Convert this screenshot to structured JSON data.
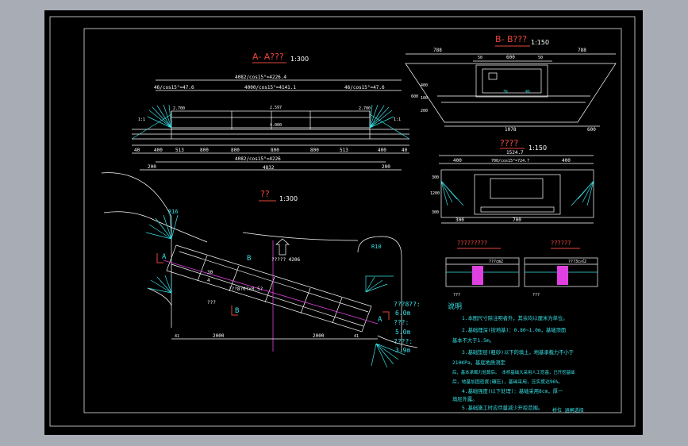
{
  "colors": {
    "background": "#a8acb5",
    "paper": "#000000",
    "line": "#ffffff",
    "annotation": "#35e0e6",
    "axis": "#e040e0",
    "title": "#e6463c"
  },
  "section_aa": {
    "title": "A- A???",
    "scale": "1:300",
    "dims_top": [
      "4082/cos15°=4226.4",
      "46/cos15°=47.6",
      "4000/cos15°=4141.1",
      "46/cos15°=47.6"
    ],
    "dims_bottom": [
      "40",
      "400",
      "513",
      "800",
      "800",
      "800",
      "800",
      "513",
      "400",
      "40"
    ],
    "dim_total": "4082/cos15°=4226",
    "dim_overall": "4832",
    "dim_200_left": "200",
    "dim_200_right": "200",
    "levels": [
      "2.700",
      "2.597",
      "4.000",
      "2.700"
    ],
    "slope_labels": [
      "1:1",
      "1:1"
    ]
  },
  "section_bb": {
    "title": "B- B???",
    "scale": "1:150",
    "dims_top": [
      "788",
      "50",
      "600",
      "50",
      "788"
    ],
    "dims_side": [
      "400",
      "100",
      "200",
      "600"
    ],
    "dims_bottom": [
      "1078",
      "600"
    ],
    "inner_marks": [
      "3%",
      "4%"
    ]
  },
  "section_end": {
    "title": "????",
    "scale": "1:150",
    "dims_top": [
      "1524.7",
      "400",
      "700/cos15°=724.7",
      "400"
    ],
    "dims_side": [
      "300",
      "1200",
      "300"
    ],
    "dims_bottom": [
      "700",
      "300"
    ]
  },
  "plan": {
    "title": "??",
    "scale": "1:300",
    "labels": [
      "R16",
      "R10",
      "B",
      "B",
      "A",
      "A"
    ],
    "skew": "?????\n4206",
    "span_mark": "???8?0?x0.5?",
    "angle_mark": "???",
    "dims_bottom": [
      "2000",
      "2000",
      "41",
      "41"
    ],
    "dims_left": [
      "30",
      "4"
    ],
    "legend": [
      "???8??:",
      "6.0m",
      "???:",
      "5.0m",
      "????:",
      "3.9m"
    ]
  },
  "details": {
    "left_title": "?????????",
    "right_title": "??????",
    "left_marks": [
      "???cm2",
      "???"
    ],
    "right_marks": [
      "???3c㎡2",
      "???"
    ]
  },
  "notes": {
    "heading": "说明",
    "items": [
      "1.本图尺寸除注明者外，其余均以厘米为单位。",
      "2.基础埋深(按地基)：0.80~1.0m，基础顶面",
      "基本不大于1.5m。",
      "3.基础垫层(粗砂)以下的填土，地基承载力不小于",
      "210KPa，基底地质测定",
      "后，基本承载力验算后。  本桥基础大采用人工挖基，已开挖基础",
      "后，地基加固密度(碾压)，基础采用，压实度达96%。",
      "4.基础强度(以下处理)：基础采用8cm，厚一",
      "填层外露。",
      "5.基础施工时应尽量减少开挖范围。"
    ],
    "stamp": "桥位 涵闸选择"
  }
}
